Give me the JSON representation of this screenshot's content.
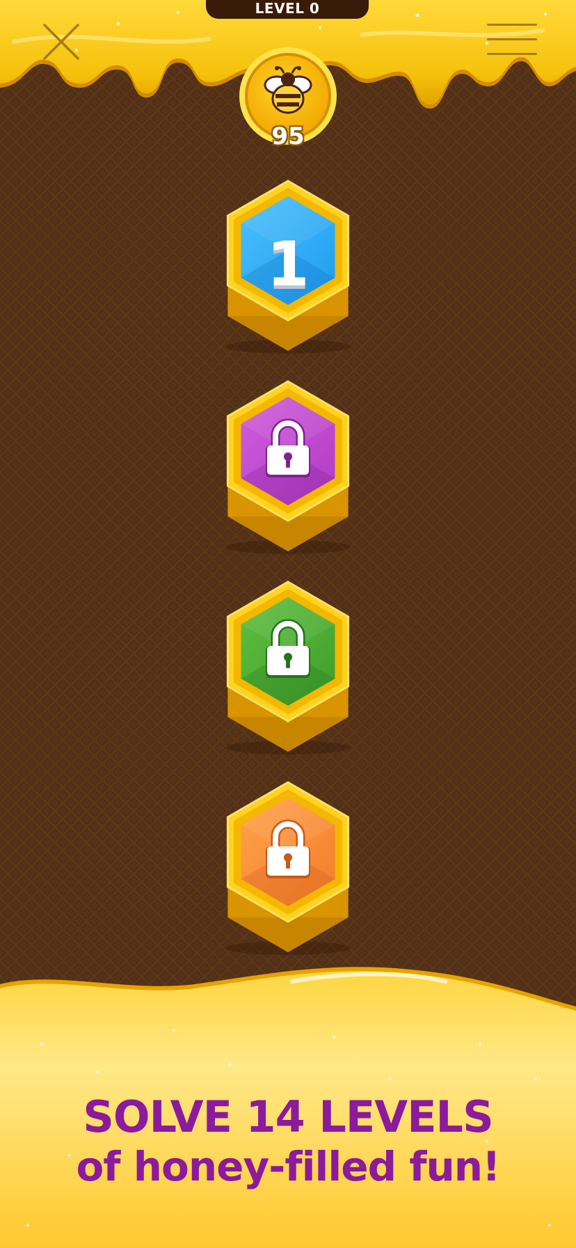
{
  "header": {
    "level_label": "LEVEL 0",
    "bee_count": "95"
  },
  "levels": [
    {
      "label": "1",
      "locked": false,
      "color": "#1e9cf0",
      "color_light": "#4bc0fb",
      "color_dark": "#0f6fc0"
    },
    {
      "label": "",
      "locked": true,
      "color": "#b23bc4",
      "color_light": "#cf5cdc",
      "color_dark": "#7e2293"
    },
    {
      "label": "",
      "locked": true,
      "color": "#3f9e2a",
      "color_light": "#5fbf3f",
      "color_dark": "#24741b"
    },
    {
      "label": "",
      "locked": true,
      "color": "#f47d2a",
      "color_light": "#ffa24a",
      "color_dark": "#c95a16"
    }
  ],
  "promo": {
    "line1": "SOLVE 14 LEVELS",
    "line2": "of honey-filled fun!"
  },
  "colors": {
    "honey": "#f8c613",
    "honey_light": "#ffe26a",
    "board": "#5a3518",
    "promo_text": "#8b1a9c"
  },
  "icons": {
    "close": "close-icon",
    "menu": "hamburger-menu-icon",
    "bee": "bee-icon",
    "lock": "padlock-icon"
  }
}
